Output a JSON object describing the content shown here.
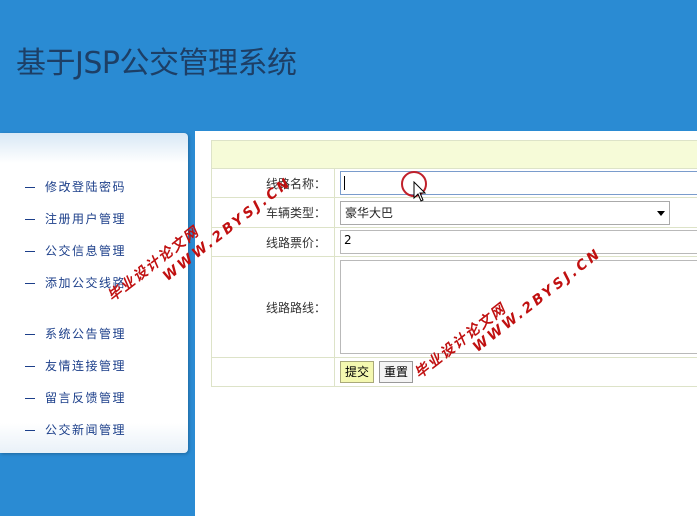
{
  "app": {
    "title": "基于JSP公交管理系统"
  },
  "sidebar": {
    "groups": [
      {
        "items": [
          {
            "label": "修改登陆密码"
          },
          {
            "label": "注册用户管理"
          },
          {
            "label": "公交信息管理"
          },
          {
            "label": "添加公交线路"
          }
        ]
      },
      {
        "items": [
          {
            "label": "系统公告管理"
          },
          {
            "label": "友情连接管理"
          },
          {
            "label": "留言反馈管理"
          },
          {
            "label": "公交新闻管理"
          }
        ]
      }
    ]
  },
  "form": {
    "route_name": {
      "label": "线路名称：",
      "value": ""
    },
    "vehicle_type": {
      "label": "车辆类型：",
      "value": "豪华大巴"
    },
    "fare": {
      "label": "线路票价：",
      "value": "2"
    },
    "route_path": {
      "label": "线路路线：",
      "value": ""
    },
    "submit_label": "提交",
    "reset_label": "重置"
  },
  "watermarks": [
    {
      "line1": "毕业设计论文网",
      "line2": "WWW.2BYSJ.CN"
    },
    {
      "line1": "毕业设计论文网",
      "line2": "WWW.2BYSJ.CN"
    }
  ],
  "colors": {
    "header": "#2a8bd3",
    "title": "#1d3f66",
    "menu_text": "#1c3f8a",
    "form_header": "#f6fbd8",
    "watermark": "#c01010"
  }
}
